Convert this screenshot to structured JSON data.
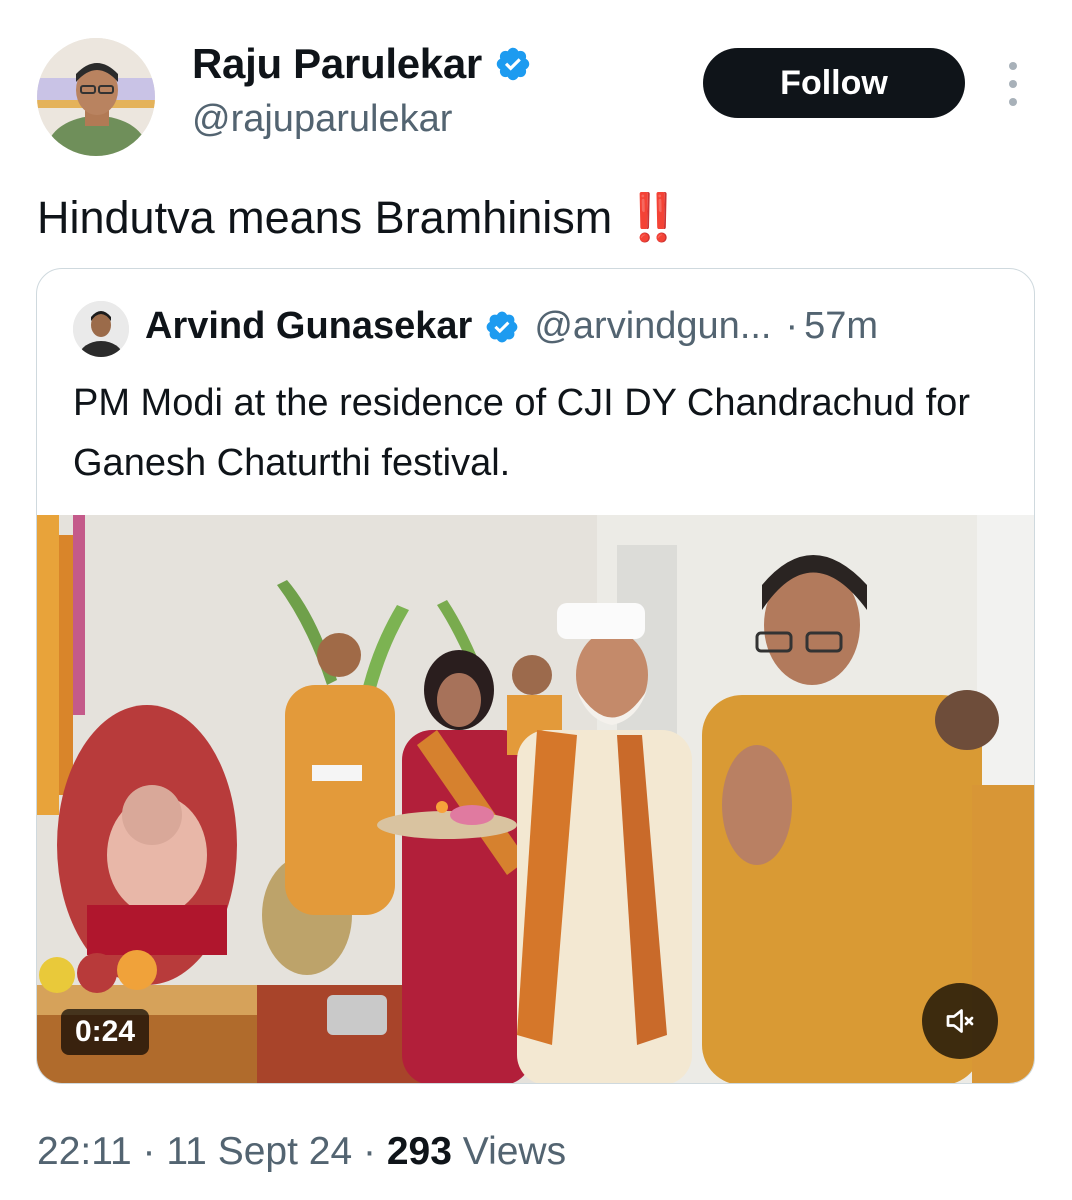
{
  "author": {
    "name": "Raju Parulekar",
    "handle": "@rajuparulekar",
    "verified_icon": "verified-badge-icon"
  },
  "follow_button": {
    "label": "Follow"
  },
  "more_icon": "more-vertical-icon",
  "tweet": {
    "text": "Hindutva means Bramhinism",
    "emoji": "‼️"
  },
  "quoted": {
    "name": "Arvind Gunasekar",
    "handle": "@arvindgun...",
    "separator": "·",
    "time": "57m",
    "text": "PM Modi at the residence of CJI DY Chandrachud for Ganesh Chaturthi festival.",
    "video": {
      "duration": "0:24",
      "mute_icon": "volume-muted-icon"
    }
  },
  "meta": {
    "time": "22:11",
    "sep1": "·",
    "date": "11 Sept 24",
    "sep2": "·",
    "views_count": "293",
    "views_label": "Views"
  },
  "colors": {
    "text": "#0f1419",
    "secondary": "#536471",
    "verified": "#1d9bf0",
    "border": "#cfd9de",
    "button_bg": "#0f1419"
  }
}
